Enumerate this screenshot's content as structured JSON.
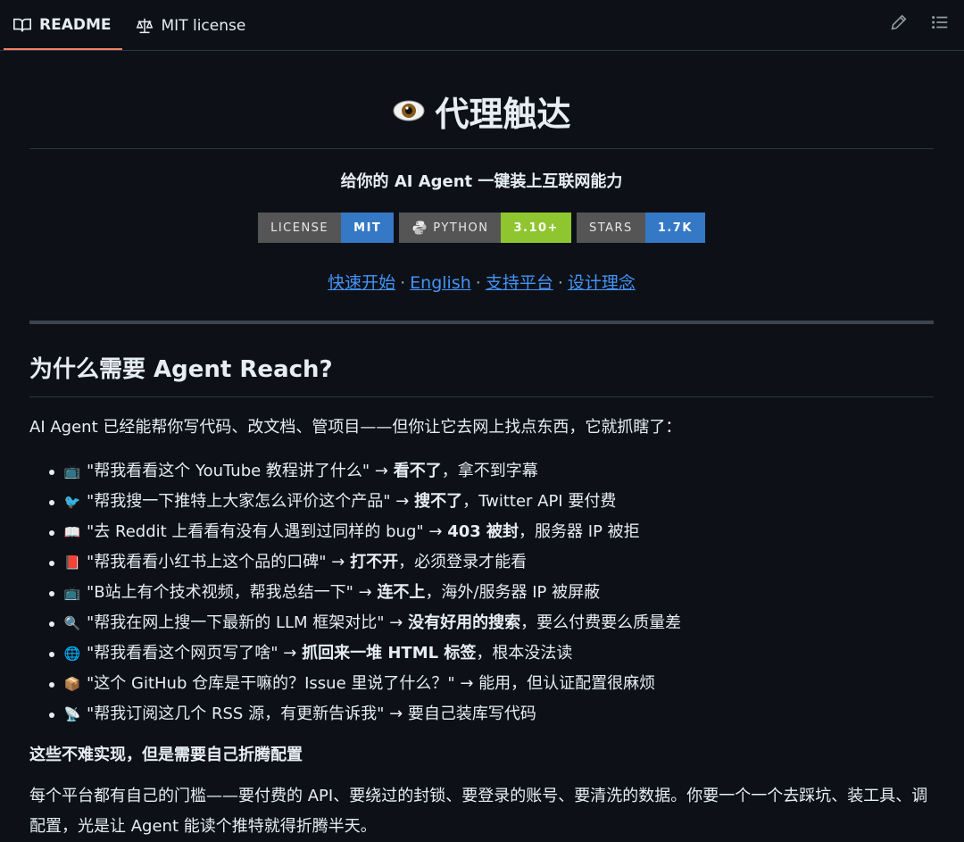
{
  "tabs": [
    {
      "label": "README",
      "icon": "book-icon",
      "active": true
    },
    {
      "label": "MIT license",
      "icon": "scale-icon",
      "active": false
    }
  ],
  "actions": [
    "edit-icon",
    "list-icon"
  ],
  "title": "代理触达",
  "title_icon": "eye-icon",
  "subtitle": "给你的 AI Agent 一键装上互联网能力",
  "badges": [
    {
      "label": "LICENSE",
      "value": "MIT",
      "color": "#3478c6"
    },
    {
      "label": "PYTHON",
      "value": "3.10+",
      "color": "#8fc62f"
    },
    {
      "label": "STARS",
      "value": "1.7K",
      "color": "#3478c6"
    }
  ],
  "links": [
    "快速开始",
    "English",
    "支持平台",
    "设计理念"
  ],
  "links_separator": "·",
  "section_title": "为什么需要 Agent Reach?",
  "intro": "AI Agent 已经能帮你写代码、改文档、管项目——但你让它去网上找点东西，它就抓瞎了：",
  "items": [
    {
      "emoji": "📺",
      "quote": "\"帮我看看这个 YouTube 教程讲了什么\" → ",
      "bold": "看不了",
      "rest": "，拿不到字幕"
    },
    {
      "emoji": "🐦",
      "quote": "\"帮我搜一下推特上大家怎么评价这个产品\" → ",
      "bold": "搜不了",
      "rest": "，Twitter API 要付费"
    },
    {
      "emoji": "📖",
      "quote": "\"去 Reddit 上看看有没有人遇到过同样的 bug\" → ",
      "bold": "403 被封",
      "rest": "，服务器 IP 被拒"
    },
    {
      "emoji": "📕",
      "quote": "\"帮我看看小红书上这个品的口碑\" → ",
      "bold": "打不开",
      "rest": "，必须登录才能看"
    },
    {
      "emoji": "📺",
      "quote": "\"B站上有个技术视频，帮我总结一下\" → ",
      "bold": "连不上",
      "rest": "，海外/服务器 IP 被屏蔽"
    },
    {
      "emoji": "🔍",
      "quote": "\"帮我在网上搜一下最新的 LLM 框架对比\" → ",
      "bold": "没有好用的搜索",
      "rest": "，要么付费要么质量差"
    },
    {
      "emoji": "🌐",
      "quote": "\"帮我看看这个网页写了啥\" → ",
      "bold": "抓回来一堆 HTML 标签",
      "rest": "，根本没法读"
    },
    {
      "emoji": "📦",
      "quote": "\"这个 GitHub 仓库是干嘛的？Issue 里说了什么？\" → 能用，但认证配置很麻烦",
      "bold": "",
      "rest": ""
    },
    {
      "emoji": "📡",
      "quote": "\"帮我订阅这几个 RSS 源，有更新告诉我\" → 要自己装库写代码",
      "bold": "",
      "rest": ""
    }
  ],
  "strong_line": "这些不难实现，但是需要自己折腾配置",
  "closing": "每个平台都有自己的门槛——要付费的 API、要绕过的封锁、要登录的账号、要清洗的数据。你要一个一个去踩坑、装工具、调配置，光是让 Agent 能读个推特就得折腾半天。"
}
